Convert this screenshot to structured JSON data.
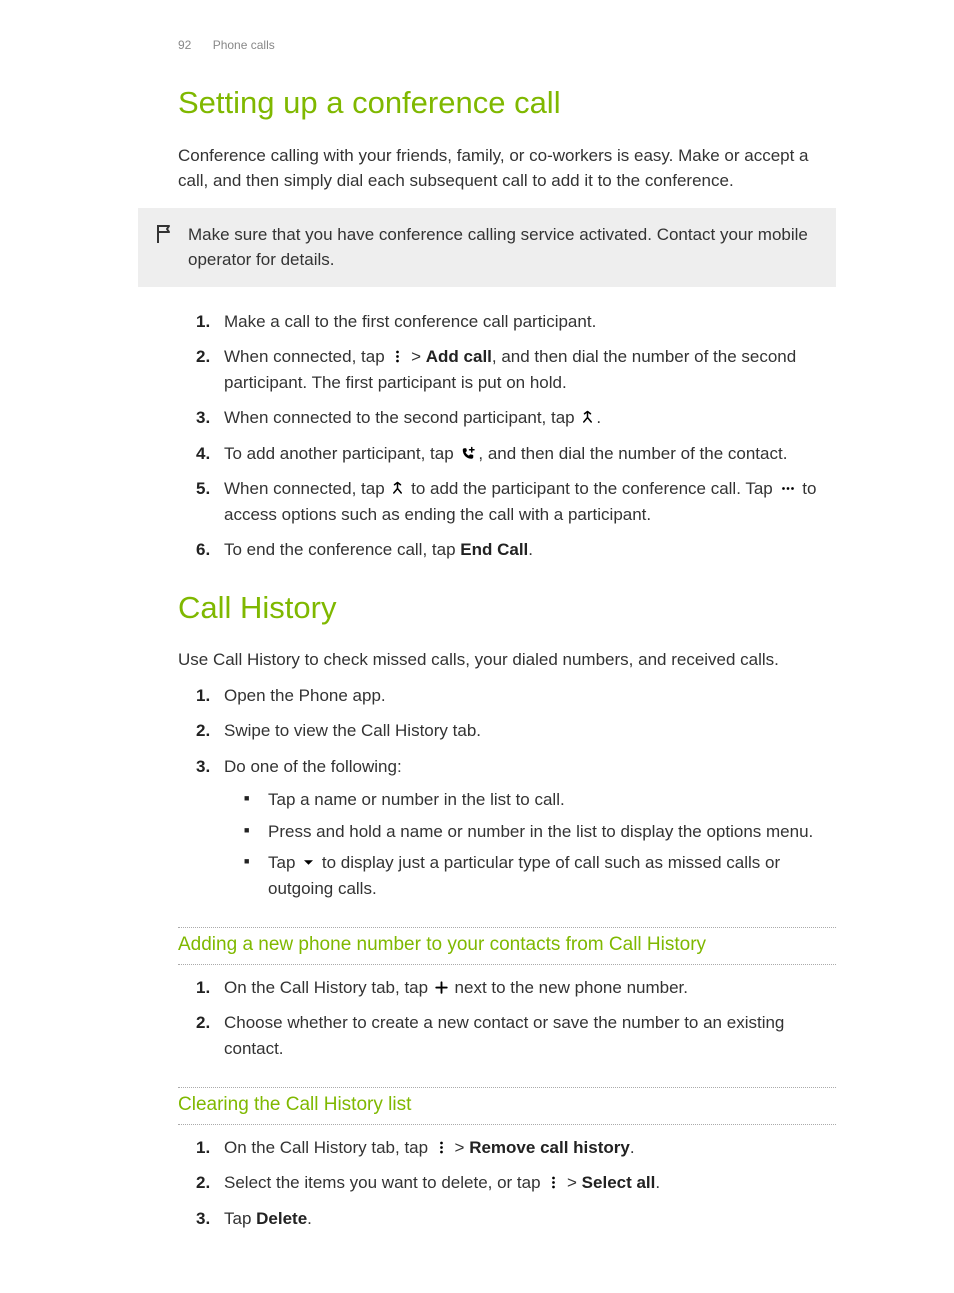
{
  "header": {
    "page_number": "92",
    "section": "Phone calls"
  },
  "s1": {
    "title": "Setting up a conference call",
    "intro": "Conference calling with your friends, family, or co-workers is easy. Make or accept a call, and then simply dial each subsequent call to add it to the conference.",
    "note": "Make sure that you have conference calling service activated. Contact your mobile operator for details.",
    "steps": {
      "1": "Make a call to the first conference call participant.",
      "2_a": "When connected, tap ",
      "2_b": " > ",
      "2_c": "Add call",
      "2_d": ", and then dial the number of the second participant. The first participant is put on hold.",
      "3_a": "When connected to the second participant, tap ",
      "3_b": ".",
      "4_a": "To add another participant, tap ",
      "4_b": ", and then dial the number of the contact.",
      "5_a": "When connected, tap ",
      "5_b": " to add the participant to the conference call. Tap ",
      "5_c": " to access options such as ending the call with a participant.",
      "6_a": "To end the conference call, tap ",
      "6_b": "End Call",
      "6_c": "."
    }
  },
  "s2": {
    "title": "Call History",
    "intro": "Use Call History to check missed calls, your dialed numbers, and received calls.",
    "steps": {
      "1": "Open the Phone app.",
      "2": "Swipe to view the Call History tab.",
      "3": "Do one of the following:",
      "3_bullets": {
        "a": "Tap a name or number in the list to call.",
        "b": "Press and hold a name or number in the list to display the options menu.",
        "c_a": "Tap ",
        "c_b": " to display just a particular type of call such as missed calls or outgoing calls."
      }
    },
    "sub_add": {
      "title": "Adding a new phone number to your contacts from Call History",
      "1_a": "On the Call History tab, tap ",
      "1_b": " next to the new phone number.",
      "2": "Choose whether to create a new contact or save the number to an existing contact."
    },
    "sub_clear": {
      "title": "Clearing the Call History list",
      "1_a": "On the Call History tab, tap ",
      "1_b": " > ",
      "1_c": "Remove call history",
      "1_d": ".",
      "2_a": "Select the items you want to delete, or tap ",
      "2_b": " > ",
      "2_c": "Select all",
      "2_d": ".",
      "3_a": "Tap ",
      "3_b": "Delete",
      "3_c": "."
    }
  }
}
